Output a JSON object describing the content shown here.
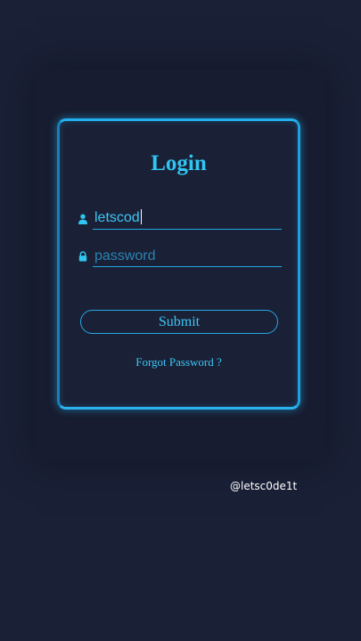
{
  "login": {
    "title": "Login",
    "username": {
      "value": "letscod",
      "icon": "user-icon"
    },
    "password": {
      "placeholder": "password",
      "icon": "lock-icon"
    },
    "submit_label": "Submit",
    "forgot_label": "Forgot Password ?"
  },
  "watermark": "@letsc0de1t",
  "colors": {
    "background": "#1a2036",
    "accent": "#2fc6f2",
    "border": "#22b0ee",
    "watermark": "#ffffff"
  }
}
